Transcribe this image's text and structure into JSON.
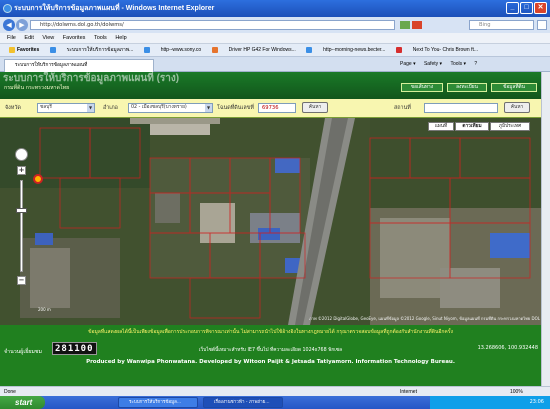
{
  "window": {
    "title": "ระบบการให้บริการข้อมูลภาพแผนที่ - Windows Internet Explorer",
    "minimize": "_",
    "maximize": "□",
    "close": "✕"
  },
  "address": {
    "url": "http://dolwms.dol.go.th/dolwms/",
    "search_placeholder": "Bing"
  },
  "menu": [
    "File",
    "Edit",
    "View",
    "Favorites",
    "Tools",
    "Help"
  ],
  "favorites": {
    "label": "Favorites",
    "items": [
      "ระบบการให้บริการข้อมูลภาพ...",
      "http--www.sony.co",
      "Driver HP G42 For Windows...",
      "http--morning-news.becter...",
      "Next To You- Chris Brown ft..."
    ]
  },
  "tabbar": {
    "active_tab": "ระบบการให้บริการข้อมูลภาพแผนที่",
    "tools": [
      "Page ▾",
      "Safety ▾",
      "Tools ▾",
      "?"
    ]
  },
  "header": {
    "title": "ระบบการให้บริการข้อมูลภาพแผนที่ (ราง)",
    "subtitle": "กรมที่ดิน กระทรวงมหาดไทย",
    "buttons": [
      "ขอเส้นทาง",
      "ลงทะเบียน",
      "ข้อมูลที่ดิน"
    ]
  },
  "form": {
    "province_label": "จังหวัด",
    "province_value": "ชลบุรี",
    "district_label": "อำเภอ",
    "district_value": "02 - เมืองชลบุรี(บางทราย)",
    "parcel_label": "โฉนดที่ดินเลขที่",
    "parcel_value": "69736",
    "search_button": "ค้นหา",
    "place_label": "สถานที่",
    "place_value": "",
    "place_search_button": "ค้นหา"
  },
  "map": {
    "types": [
      "แผนที่",
      "ดาวเทียม",
      "ภูมิประเทศ"
    ],
    "zoom_in": "+",
    "zoom_out": "−",
    "scale": "200 m",
    "copyright": "ภาพ ©2012 DigitalGlobe, GeoEye, แผนที่ข้อมูล ©2012 Google, Sinut Niyom, ข้อมูลแผนที่ กรมที่ดิน กระทรวงมหาดไทย DOL"
  },
  "footer": {
    "notice": "ข้อมูลที่แสดงผลได้นี้เป็นเพียงข้อมูลเพื่อการประกอบการพิจารณาเท่านั้น ไม่สามารถนำไปใช้อ้างอิงในทางกฎหมายได้ กรุณาตรวจสอบข้อมูลที่ถูกต้องกับสำนักงานที่ดินอีกครั้ง",
    "counter_label": "จำนวนผู้เยี่ยมชม",
    "counter": "281100",
    "resolution": "เว็บไซต์นี้เหมาะสำหรับ IE7 ขึ้นไป ที่ความละเอียด 1024x768 พิกเซล",
    "coords": "13.268606, 100.932448",
    "credits": "Produced by Wanwipa Phonwatana. Developed by Witoon Paijit & Jetsada Tatiyamorn. Information Technology Bureau."
  },
  "status": {
    "left": "Done",
    "zone": "Internet",
    "zoom": "100%"
  },
  "taskbar": {
    "start": "start",
    "tasks": [
      "ระบบการให้บริการข้อมูล...",
      "เรื่องงานชาวฟ้า - ภาพถ่าย..."
    ],
    "clock": "23:06"
  }
}
